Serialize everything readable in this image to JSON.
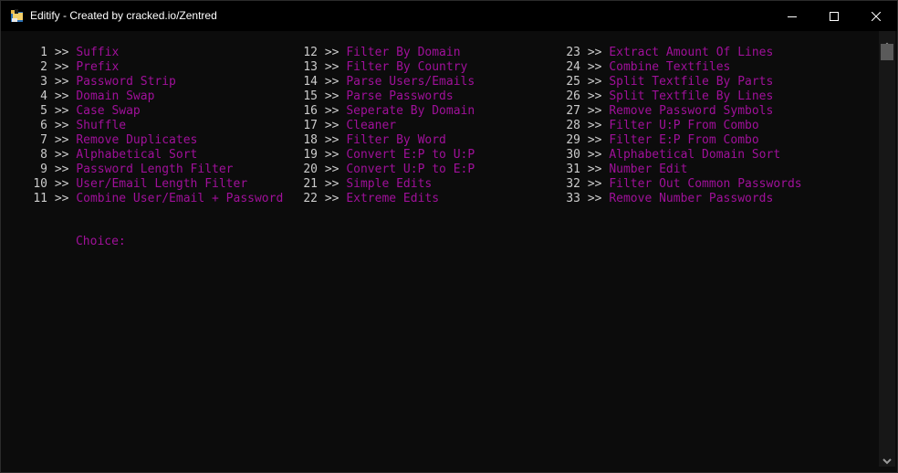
{
  "window": {
    "title": "Editify - Created by cracked.io/Zentred",
    "icon": "app-folder-icon",
    "controls": [
      "minimize-icon",
      "maximize-icon",
      "close-icon"
    ]
  },
  "colors": {
    "background": "#0c0c0c",
    "number_text": "#cccccc",
    "label_text": "#a0109a",
    "titlebar": "#000000"
  },
  "menu": {
    "separator": ">>",
    "columns": [
      [
        {
          "num": "1",
          "label": "Suffix"
        },
        {
          "num": "2",
          "label": "Prefix"
        },
        {
          "num": "3",
          "label": "Password Strip"
        },
        {
          "num": "4",
          "label": "Domain Swap"
        },
        {
          "num": "5",
          "label": "Case Swap"
        },
        {
          "num": "6",
          "label": "Shuffle"
        },
        {
          "num": "7",
          "label": "Remove Duplicates"
        },
        {
          "num": "8",
          "label": "Alphabetical Sort"
        },
        {
          "num": "9",
          "label": "Password Length Filter"
        },
        {
          "num": "10",
          "label": "User/Email Length Filter"
        },
        {
          "num": "11",
          "label": "Combine User/Email + Password"
        }
      ],
      [
        {
          "num": "12",
          "label": "Filter By Domain"
        },
        {
          "num": "13",
          "label": "Filter By Country"
        },
        {
          "num": "14",
          "label": "Parse Users/Emails"
        },
        {
          "num": "15",
          "label": "Parse Passwords"
        },
        {
          "num": "16",
          "label": "Seperate By Domain"
        },
        {
          "num": "17",
          "label": "Cleaner"
        },
        {
          "num": "18",
          "label": "Filter By Word"
        },
        {
          "num": "19",
          "label": "Convert E:P to U:P"
        },
        {
          "num": "20",
          "label": "Convert U:P to E:P"
        },
        {
          "num": "21",
          "label": "Simple Edits"
        },
        {
          "num": "22",
          "label": "Extreme Edits"
        }
      ],
      [
        {
          "num": "23",
          "label": "Extract Amount Of Lines"
        },
        {
          "num": "24",
          "label": "Combine Textfiles"
        },
        {
          "num": "25",
          "label": "Split Textfile By Parts"
        },
        {
          "num": "26",
          "label": "Split Textfile By Lines"
        },
        {
          "num": "27",
          "label": "Remove Password Symbols"
        },
        {
          "num": "28",
          "label": "Filter U:P From Combo"
        },
        {
          "num": "29",
          "label": "Filter E:P From Combo"
        },
        {
          "num": "30",
          "label": "Alphabetical Domain Sort"
        },
        {
          "num": "31",
          "label": "Number Edit"
        },
        {
          "num": "32",
          "label": "Filter Out Common Passwords"
        },
        {
          "num": "33",
          "label": "Remove Number Passwords"
        }
      ]
    ]
  },
  "prompt": {
    "label": "Choice:",
    "value": ""
  }
}
